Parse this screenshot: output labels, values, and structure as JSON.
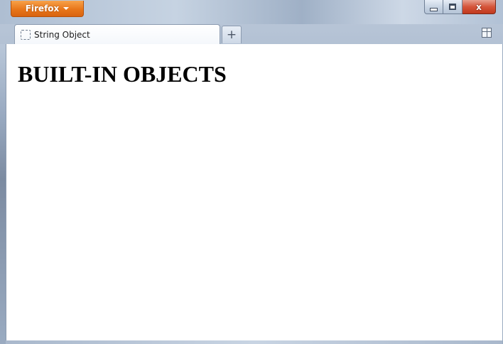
{
  "window": {
    "firefox_menu_label": "Firefox",
    "controls": {
      "minimize_icon": "minimize-icon",
      "maximize_icon": "maximize-icon",
      "close_glyph": "x"
    }
  },
  "tabs": [
    {
      "label": "String Object",
      "icon": "dashed-page-icon",
      "active": true
    }
  ],
  "tabstrip": {
    "new_tab_glyph": "+",
    "tab_groups_icon": "tab-groups-icon"
  },
  "page": {
    "heading": "BUILT-IN OBJECTS"
  },
  "colors": {
    "firefox_button": "#e8761a",
    "close_button": "#d5553a",
    "chrome_frame": "#b8c6d8",
    "content_background": "#ffffff"
  }
}
